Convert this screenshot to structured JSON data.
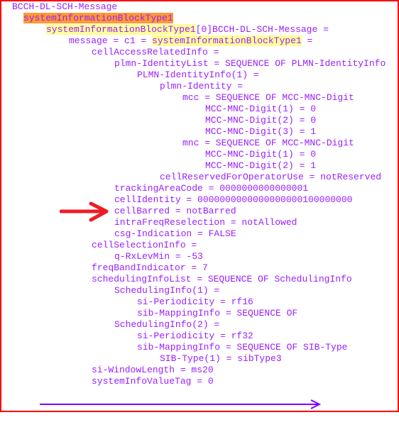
{
  "lines": [
    {
      "indent": 0,
      "parts": [
        {
          "t": "BCCH-DL-SCH-Message"
        }
      ]
    },
    {
      "indent": 1,
      "parts": [
        {
          "t": "systemInformationBlockType1",
          "hl": "orange"
        }
      ]
    },
    {
      "indent": 2,
      "parts": [
        {
          "t": "systemInformationBlockType1",
          "hl": "yellow"
        },
        {
          "t": "[0]BCCH-DL-SCH-Message ="
        }
      ]
    },
    {
      "indent": 3,
      "parts": [
        {
          "t": "message = c1 = "
        },
        {
          "t": "systemInformationBlockType1",
          "hl": "yellow"
        },
        {
          "t": " ="
        }
      ]
    },
    {
      "indent": 4,
      "parts": [
        {
          "t": "cellAccessRelatedInfo ="
        }
      ]
    },
    {
      "indent": 5,
      "parts": [
        {
          "t": "plmn-IdentityList = SEQUENCE OF PLMN-IdentityInfo"
        }
      ]
    },
    {
      "indent": 6,
      "parts": [
        {
          "t": "PLMN-IdentityInfo(1) ="
        }
      ]
    },
    {
      "indent": 7,
      "parts": [
        {
          "t": "plmn-Identity ="
        }
      ]
    },
    {
      "indent": 8,
      "parts": [
        {
          "t": "mcc = SEQUENCE OF MCC-MNC-Digit"
        }
      ]
    },
    {
      "indent": 9,
      "parts": [
        {
          "t": "MCC-MNC-Digit(1) = 0"
        }
      ]
    },
    {
      "indent": 9,
      "parts": [
        {
          "t": "MCC-MNC-Digit(2) = 0"
        }
      ]
    },
    {
      "indent": 9,
      "parts": [
        {
          "t": "MCC-MNC-Digit(3) = 1"
        }
      ]
    },
    {
      "indent": 8,
      "parts": [
        {
          "t": "mnc = SEQUENCE OF MCC-MNC-Digit"
        }
      ]
    },
    {
      "indent": 9,
      "parts": [
        {
          "t": "MCC-MNC-Digit(1) = 0"
        }
      ]
    },
    {
      "indent": 9,
      "parts": [
        {
          "t": "MCC-MNC-Digit(2) = 1"
        }
      ]
    },
    {
      "indent": 7,
      "parts": [
        {
          "t": "cellReservedForOperatorUse = notReserved"
        }
      ]
    },
    {
      "indent": 5,
      "parts": [
        {
          "t": "trackingAreaCode = 0000000000000001"
        }
      ]
    },
    {
      "indent": 5,
      "parts": [
        {
          "t": "cellIdentity = 0000000000000000000100000000"
        }
      ]
    },
    {
      "indent": 5,
      "parts": [
        {
          "t": "cellBarred = notBarred"
        }
      ]
    },
    {
      "indent": 5,
      "parts": [
        {
          "t": "intraFreqReselection = notAllowed"
        }
      ]
    },
    {
      "indent": 5,
      "parts": [
        {
          "t": "csg-Indication = FALSE"
        }
      ]
    },
    {
      "indent": 4,
      "parts": [
        {
          "t": "cellSelectionInfo ="
        }
      ]
    },
    {
      "indent": 5,
      "parts": [
        {
          "t": "q-RxLevMin = -53"
        }
      ]
    },
    {
      "indent": 4,
      "parts": [
        {
          "t": "freqBandIndicator = 7"
        }
      ]
    },
    {
      "indent": 4,
      "parts": [
        {
          "t": "schedulingInfoList = SEQUENCE OF SchedulingInfo"
        }
      ]
    },
    {
      "indent": 5,
      "parts": [
        {
          "t": "SchedulingInfo(1) ="
        }
      ]
    },
    {
      "indent": 6,
      "parts": [
        {
          "t": "si-Periodicity = rf16"
        }
      ]
    },
    {
      "indent": 6,
      "parts": [
        {
          "t": "sib-MappingInfo = SEQUENCE OF"
        }
      ]
    },
    {
      "indent": 5,
      "parts": [
        {
          "t": "SchedulingInfo(2) ="
        }
      ]
    },
    {
      "indent": 6,
      "parts": [
        {
          "t": "si-Periodicity = rf32"
        }
      ]
    },
    {
      "indent": 6,
      "parts": [
        {
          "t": "sib-MappingInfo = SEQUENCE OF SIB-Type"
        }
      ]
    },
    {
      "indent": 7,
      "parts": [
        {
          "t": "SIB-Type(1) = sibType3"
        }
      ]
    },
    {
      "indent": 4,
      "parts": [
        {
          "t": "si-WindowLength = ms20"
        }
      ]
    },
    {
      "indent": 4,
      "parts": [
        {
          "t": "systemInfoValueTag = 0"
        }
      ]
    }
  ],
  "colors": {
    "text": "#9b1fff",
    "frame": "#ff0000",
    "highlight_orange": "#ff9933",
    "highlight_yellow": "#ffff99",
    "annotation_arrow": "#ee1c25",
    "scroll_arrow": "#8000ff"
  },
  "icons": {
    "annotation": "red-arrow-icon",
    "bottom": "right-arrow-icon"
  }
}
